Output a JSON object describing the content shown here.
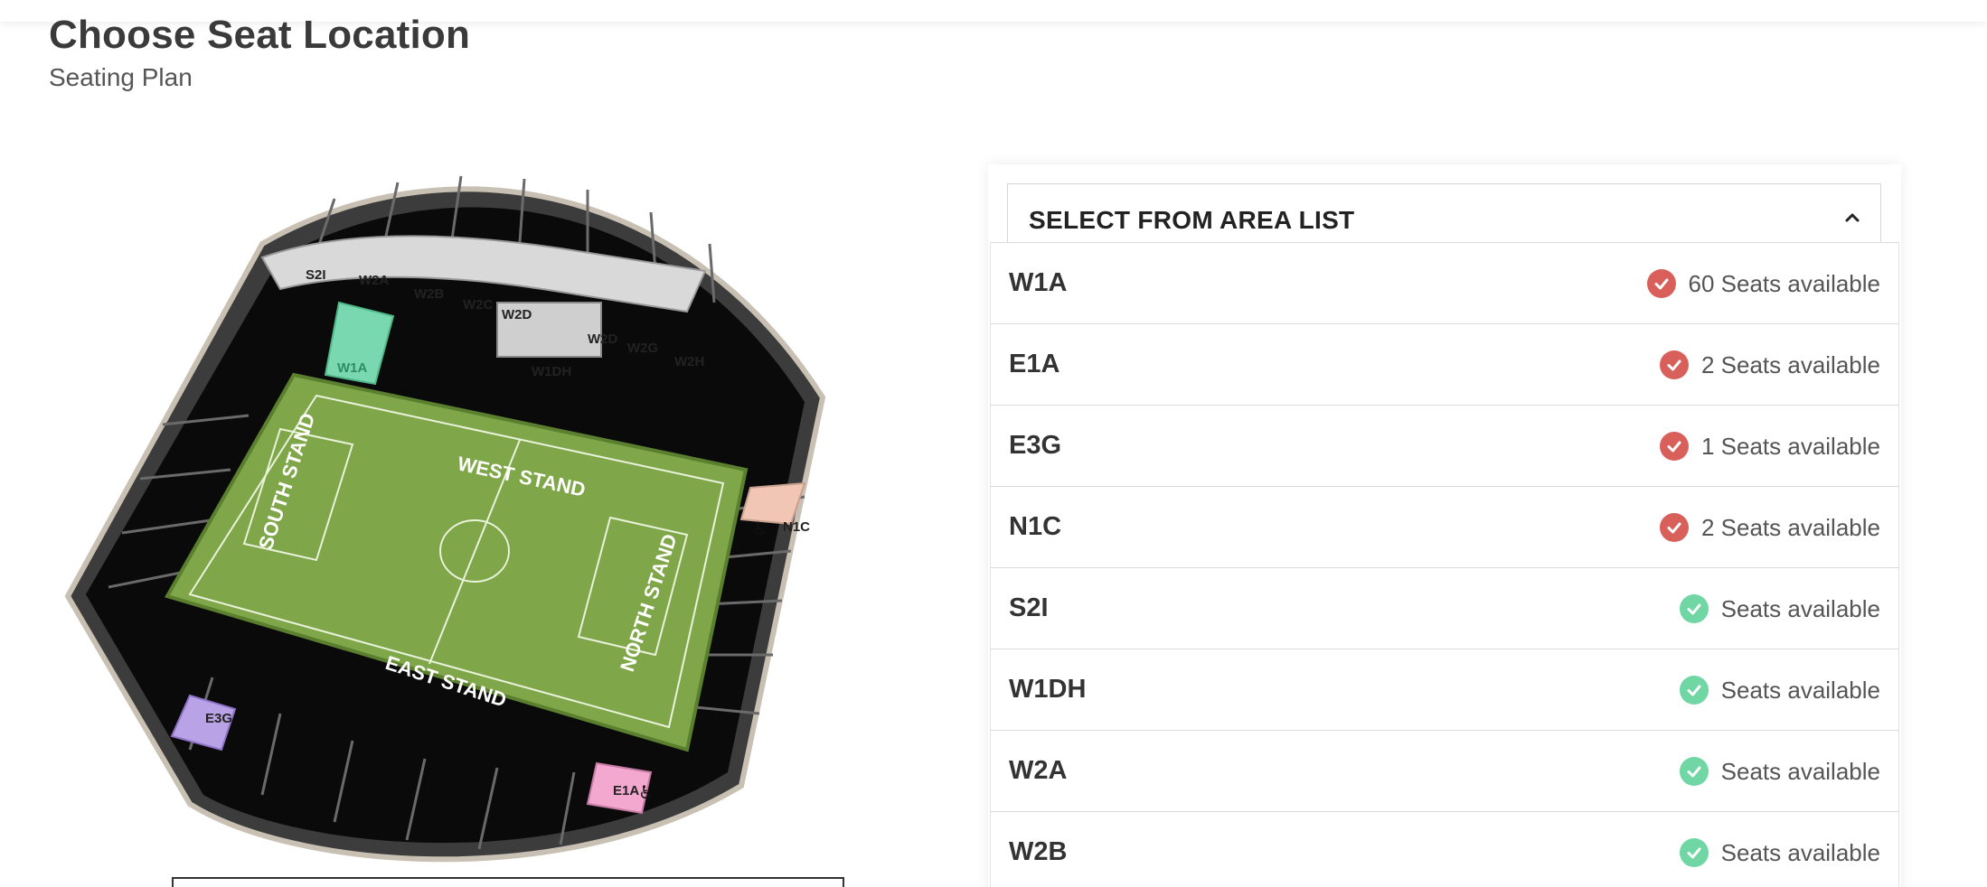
{
  "page": {
    "title": "Choose Seat Location",
    "subtitle": "Seating Plan"
  },
  "colors": {
    "limited": "#d9605a",
    "available": "#6fd6a4",
    "pitch": "#7fa648",
    "selected_block": "#79d8b0"
  },
  "stadium_map": {
    "stand_labels": [
      "WEST STAND",
      "EAST STAND",
      "SOUTH STAND",
      "NORTH STAND"
    ],
    "block_labels": [
      "S2I",
      "W2A",
      "W2B",
      "W2C",
      "W2D",
      "W2D",
      "W2G",
      "W2H",
      "W1DH",
      "W1A",
      "N1C",
      "E3G",
      "E1A"
    ]
  },
  "area_list": {
    "header": "SELECT FROM AREA LIST",
    "chevron": "chevron-up-icon",
    "rows": [
      {
        "code": "W1A",
        "status": "60 Seats available",
        "level": "limited"
      },
      {
        "code": "E1A",
        "status": "2 Seats available",
        "level": "limited"
      },
      {
        "code": "E3G",
        "status": "1 Seats available",
        "level": "limited"
      },
      {
        "code": "N1C",
        "status": "2 Seats available",
        "level": "limited"
      },
      {
        "code": "S2I",
        "status": "Seats available",
        "level": "available"
      },
      {
        "code": "W1DH",
        "status": "Seats available",
        "level": "available"
      },
      {
        "code": "W2A",
        "status": "Seats available",
        "level": "available"
      },
      {
        "code": "W2B",
        "status": "Seats available",
        "level": "available"
      }
    ]
  }
}
